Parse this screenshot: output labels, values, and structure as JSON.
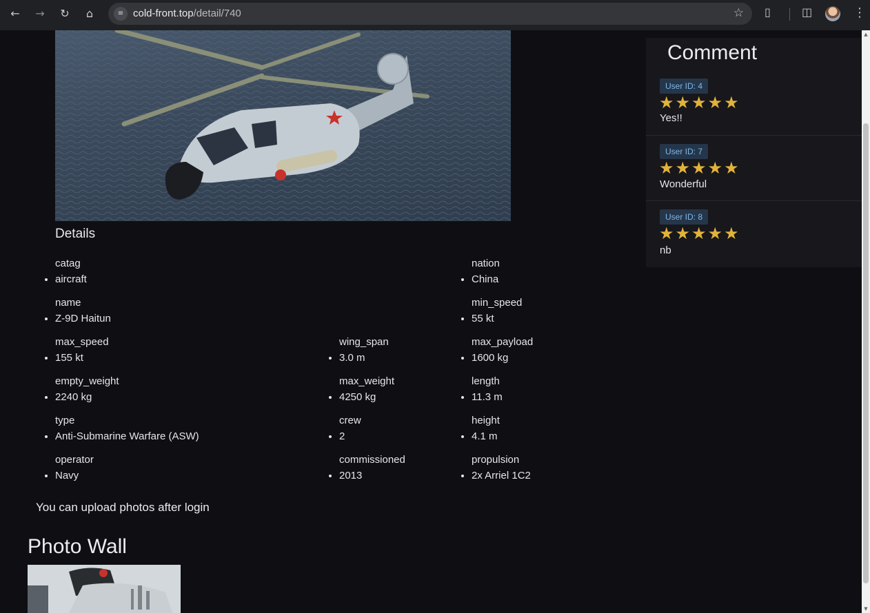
{
  "browser": {
    "url_host": "cold-front.top",
    "url_path": "/detail/740"
  },
  "details": {
    "title": "Details",
    "specs": [
      {
        "key": "catag",
        "value": "aircraft"
      },
      {
        "key": "nation",
        "value": "China"
      },
      {
        "key": "name",
        "value": "Z-9D Haitun"
      },
      {
        "key": "min_speed",
        "value": "55 kt"
      },
      {
        "key": "max_speed",
        "value": "155 kt"
      },
      {
        "key": "wing_span",
        "value": "3.0 m"
      },
      {
        "key": "max_payload",
        "value": "1600 kg"
      },
      {
        "key": "empty_weight",
        "value": "2240 kg"
      },
      {
        "key": "max_weight",
        "value": "4250 kg"
      },
      {
        "key": "length",
        "value": "11.3 m"
      },
      {
        "key": "type",
        "value": "Anti-Submarine Warfare (ASW)"
      },
      {
        "key": "crew",
        "value": "2"
      },
      {
        "key": "height",
        "value": "4.1 m"
      },
      {
        "key": "operator",
        "value": "Navy"
      },
      {
        "key": "commissioned",
        "value": "2013"
      },
      {
        "key": "propulsion",
        "value": "2x Arriel 1C2"
      }
    ]
  },
  "login_note": "You can upload photos after login",
  "photo_wall": {
    "title": "Photo Wall"
  },
  "comments": {
    "title": "Comment",
    "items": [
      {
        "user": "User ID: 4",
        "stars": "★★★★★",
        "rating": 5,
        "text": "Yes!!"
      },
      {
        "user": "User ID: 7",
        "stars": "★★★★★",
        "rating": 5,
        "text": "Wonderful"
      },
      {
        "user": "User ID: 8",
        "stars": "★★★★★",
        "rating": 5,
        "text": "nb"
      }
    ]
  },
  "colors": {
    "star": "#e2b33a",
    "badge_text": "#7fb8e8",
    "page_bg": "#0f0f13"
  }
}
